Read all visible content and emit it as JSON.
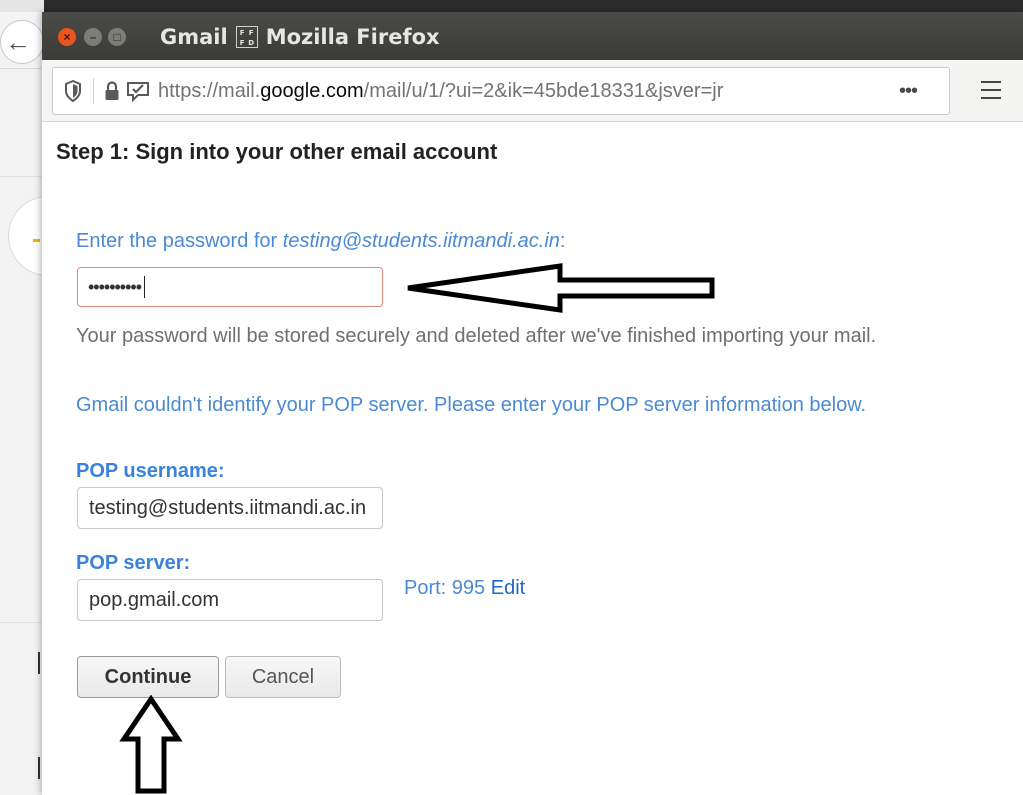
{
  "window": {
    "app_title": "Gmail",
    "missing_glyph": [
      "F",
      "F",
      "F",
      "D"
    ],
    "browser_name": "Mozilla Firefox"
  },
  "urlbar": {
    "url_prefix": "https://mail.",
    "url_domain": "google.com",
    "url_rest": "/mail/u/1/?ui=2&ik=45bde18331&jsver=jr",
    "more_label": "•••"
  },
  "form": {
    "title": "Step 1: Sign into your other email account",
    "prompt_text": "Enter the password for ",
    "prompt_email": "testing@students.iitmandi.ac.in",
    "prompt_suffix": ":",
    "password_value": "••••••••••",
    "password_note": "Your password will be stored securely and deleted after we've finished importing your mail.",
    "server_warning": "Gmail couldn't identify your POP server. Please enter your POP server information below.",
    "pop_username_label": "POP username:",
    "pop_username_value": "testing@students.iitmandi.ac.in",
    "pop_server_label": "POP server:",
    "pop_server_value": "pop.gmail.com",
    "port_label": "Port: 995",
    "edit_label": "Edit",
    "continue_label": "Continue",
    "cancel_label": "Cancel"
  },
  "colors": {
    "accent_blue": "#4a8ad4",
    "label_blue": "#3b82dd",
    "titlebar": "#3b3b38",
    "close_button": "#e9541f",
    "error_border": "#e08a7e"
  }
}
